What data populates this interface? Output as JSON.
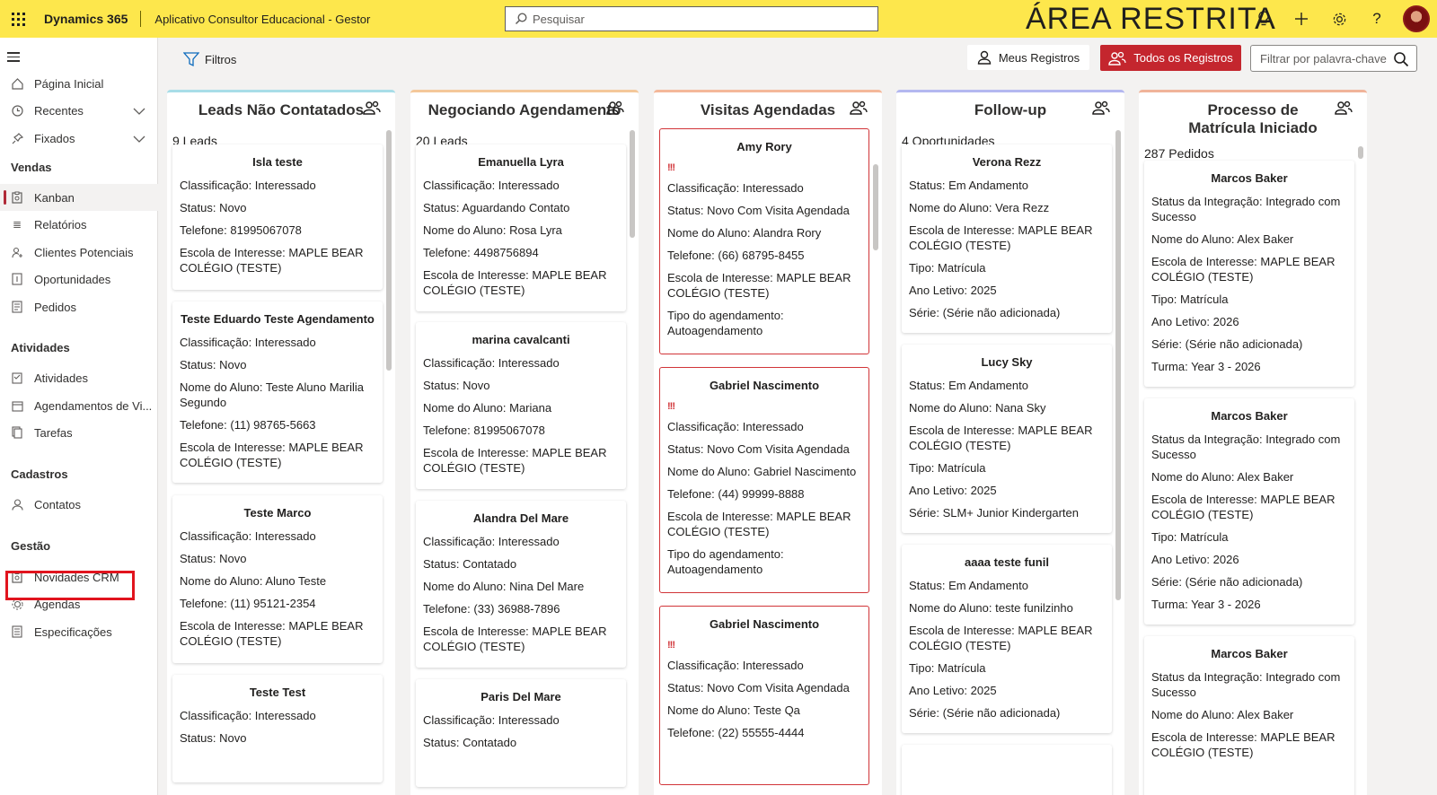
{
  "topbar": {
    "brand": "Dynamics 365",
    "app_name": "Aplicativo Consultor Educacional - Gestor",
    "search_placeholder": "Pesquisar",
    "restricted_label": "ÁREA RESTRITA"
  },
  "sidebar": {
    "items": [
      {
        "label": "Página Inicial",
        "icon": "home-icon"
      },
      {
        "label": "Recentes",
        "icon": "clock-icon"
      },
      {
        "label": "Fixados",
        "icon": "pin-icon"
      }
    ],
    "sections": [
      {
        "title": "Vendas",
        "items": [
          "Kanban",
          "Relatórios",
          "Clientes Potenciais",
          "Oportunidades",
          "Pedidos"
        ]
      },
      {
        "title": "Atividades",
        "items": [
          "Atividades",
          "Agendamentos de Vi...",
          "Tarefas"
        ]
      },
      {
        "title": "Cadastros",
        "items": [
          "Contatos"
        ]
      },
      {
        "title": "Gestão",
        "items": [
          "Novidades CRM",
          "Agendas",
          "Especificações"
        ]
      }
    ],
    "active_item": "Kanban",
    "highlighted_item": "Novidades CRM"
  },
  "commandbar": {
    "filters_label": "Filtros",
    "my_records_label": "Meus Registros",
    "all_records_label": "Todos os Registros",
    "keyword_placeholder": "Filtrar por palavra-chave"
  },
  "columns": [
    {
      "title": "Leads Não Contatados",
      "count": "9 Leads",
      "accent": "#a8dde8",
      "cards": [
        {
          "title": "Isla teste",
          "lines": [
            "Classificação: Interessado",
            "Status: Novo",
            "Telefone: 81995067078",
            "Escola de Interesse: MAPLE BEAR COLÉGIO (TESTE)"
          ]
        },
        {
          "title": "Teste Eduardo Teste Agendamento",
          "lines": [
            "Classificação: Interessado",
            "Status: Novo",
            "Nome do Aluno: Teste Aluno Marilia Segundo",
            "Telefone: (11) 98765-5663",
            "Escola de Interesse: MAPLE BEAR COLÉGIO (TESTE)"
          ]
        },
        {
          "title": "Teste Marco",
          "lines": [
            "Classificação: Interessado",
            "Status: Novo",
            "Nome do Aluno: Aluno Teste",
            "Telefone: (11) 95121-2354",
            "Escola de Interesse: MAPLE BEAR COLÉGIO (TESTE)"
          ]
        },
        {
          "title": "Teste Test",
          "lines": [
            "Classificação: Interessado",
            "Status: Novo"
          ]
        }
      ]
    },
    {
      "title": "Negociando Agendamento",
      "count": "20 Leads",
      "accent": "#f4c89a",
      "cards": [
        {
          "title": "Emanuella Lyra",
          "lines": [
            "Classificação: Interessado",
            "Status: Aguardando Contato",
            "Nome do Aluno: Rosa Lyra",
            "Telefone: 4498756894",
            "Escola de Interesse: MAPLE BEAR COLÉGIO (TESTE)"
          ]
        },
        {
          "title": "marina cavalcanti",
          "lines": [
            "Classificação: Interessado",
            "Status: Novo",
            "Nome do Aluno: Mariana",
            "Telefone: 81995067078",
            "Escola de Interesse: MAPLE BEAR COLÉGIO (TESTE)"
          ]
        },
        {
          "title": "Alandra Del Mare",
          "lines": [
            "Classificação: Interessado",
            "Status: Contatado",
            "Nome do Aluno: Nina Del Mare",
            "Telefone: (33) 36988-7896",
            "Escola de Interesse: MAPLE BEAR COLÉGIO (TESTE)"
          ]
        },
        {
          "title": "Paris Del Mare",
          "lines": [
            "Classificação: Interessado",
            "Status: Contatado"
          ]
        }
      ]
    },
    {
      "title": "Visitas Agendadas",
      "count": "",
      "accent": "#f4b89a",
      "cards": [
        {
          "title": "Amy Rory",
          "warn": "!!!",
          "lines": [
            "Classificação: Interessado",
            "Status: Novo Com Visita Agendada",
            "Nome do Aluno: Alandra Rory",
            "Telefone: (66) 68795-8455",
            "Escola de Interesse: MAPLE BEAR COLÉGIO (TESTE)",
            "Tipo do agendamento: Autoagendamento"
          ]
        },
        {
          "title": "Gabriel Nascimento",
          "warn": "!!!",
          "lines": [
            "Classificação: Interessado",
            "Status: Novo Com Visita Agendada",
            "Nome do Aluno: Gabriel Nascimento",
            "Telefone: (44) 99999-8888",
            "Escola de Interesse: MAPLE BEAR COLÉGIO (TESTE)",
            "Tipo do agendamento: Autoagendamento"
          ]
        },
        {
          "title": "Gabriel Nascimento",
          "warn": "!!!",
          "lines": [
            "Classificação: Interessado",
            "Status: Novo Com Visita Agendada",
            "Nome do Aluno: Teste Qa",
            "Telefone: (22) 55555-4444"
          ]
        }
      ]
    },
    {
      "title": "Follow-up",
      "count": "4 Oportunidades",
      "accent": "#b4b8f0",
      "cards": [
        {
          "title": "Verona Rezz",
          "lines": [
            "Status: Em Andamento",
            "Nome do Aluno: Vera Rezz",
            "Escola de Interesse: MAPLE BEAR COLÉGIO (TESTE)",
            "Tipo: Matrícula",
            "Ano Letivo: 2025",
            "Série: (Série não adicionada)"
          ]
        },
        {
          "title": "Lucy Sky",
          "lines": [
            "Status: Em Andamento",
            "Nome do Aluno: Nana Sky",
            "Escola de Interesse: MAPLE BEAR COLÉGIO (TESTE)",
            "Tipo: Matrícula",
            "Ano Letivo: 2025",
            "Série: SLM+ Junior Kindergarten"
          ]
        },
        {
          "title": "aaaa teste funil",
          "lines": [
            "Status: Em Andamento",
            "Nome do Aluno: teste funilzinho",
            "Escola de Interesse: MAPLE BEAR COLÉGIO (TESTE)",
            "Tipo: Matrícula",
            "Ano Letivo: 2025",
            "Série: (Série não adicionada)"
          ]
        },
        {
          "title": "",
          "lines": []
        }
      ]
    },
    {
      "title": "Processo de Matrícula Iniciado",
      "count": "287 Pedidos",
      "accent": "#f0b49a",
      "cards": [
        {
          "title": "Marcos Baker",
          "lines": [
            "Status da Integração: Integrado com Sucesso",
            "Nome do Aluno: Alex Baker",
            "Escola de Interesse: MAPLE BEAR COLÉGIO (TESTE)",
            "Tipo: Matrícula",
            "Ano Letivo: 2026",
            "Série: (Série não adicionada)",
            "Turma: Year 3 - 2026"
          ]
        },
        {
          "title": "Marcos Baker",
          "lines": [
            "Status da Integração: Integrado com Sucesso",
            "Nome do Aluno: Alex Baker",
            "Escola de Interesse: MAPLE BEAR COLÉGIO (TESTE)",
            "Tipo: Matrícula",
            "Ano Letivo: 2026",
            "Série: (Série não adicionada)",
            "Turma: Year 3 - 2026"
          ]
        },
        {
          "title": "Marcos Baker",
          "lines": [
            "Status da Integração: Integrado com Sucesso",
            "Nome do Aluno: Alex Baker",
            "Escola de Interesse: MAPLE BEAR COLÉGIO (TESTE)"
          ]
        }
      ]
    }
  ]
}
